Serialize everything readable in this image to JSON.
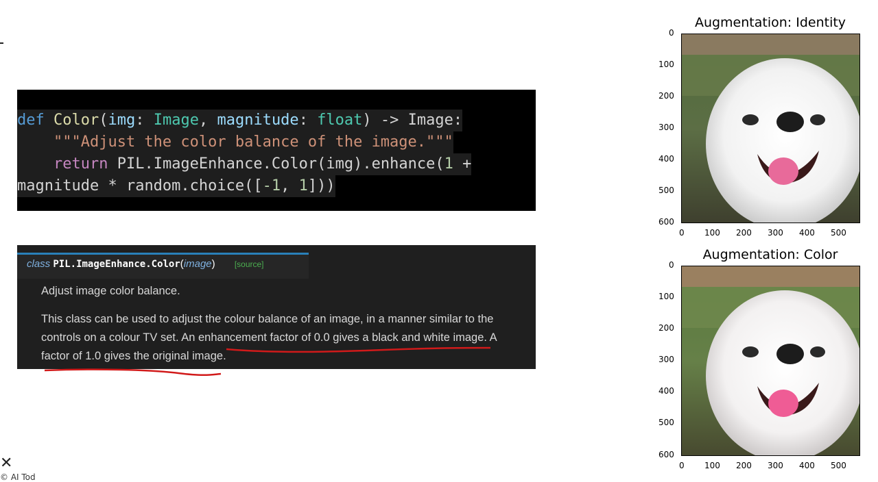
{
  "code": {
    "line1": {
      "kw": "def",
      "fn": "Color",
      "p1": "img",
      "t1": "Image",
      "p2": "magnitude",
      "t2": "float",
      "ret_type": "Image"
    },
    "line2": {
      "doc": "\"\"\"Adjust the color balance of the image.\"\"\""
    },
    "line3": {
      "kw": "return",
      "call": "PIL.ImageEnhance.Color",
      "arg": "img",
      "method": "enhance",
      "num": "1"
    },
    "line4": {
      "text1": "magnitude ",
      "op": "*",
      "text2": " random.choice([",
      "n1": "-1",
      "n2": "1",
      "close": "]))"
    }
  },
  "docs": {
    "class_kw": "class",
    "class_name": "PIL.ImageEnhance.Color",
    "arg": "image",
    "source_link": "[source]",
    "summary": "Adjust image color balance.",
    "body_line1": "This class can be used to adjust the colour balance of an image, in a manner similar to the",
    "body_line2": "controls on a colour TV set. An enhancement factor of 0.0 gives a black and white image. A",
    "body_line3": "factor of 1.0 gives the original image."
  },
  "plots": [
    {
      "title": "Augmentation: Identity",
      "yticks": [
        "0",
        "100",
        "200",
        "300",
        "400",
        "500",
        "600"
      ],
      "xticks": [
        "0",
        "100",
        "200",
        "300",
        "400",
        "500"
      ]
    },
    {
      "title": "Augmentation: Color",
      "yticks": [
        "0",
        "100",
        "200",
        "300",
        "400",
        "500",
        "600"
      ],
      "xticks": [
        "0",
        "100",
        "200",
        "300",
        "400",
        "500"
      ]
    }
  ],
  "colors": {
    "annotation": "#d11a1a",
    "code_bg": "#000000",
    "doc_bg": "#1f1f1f"
  },
  "icons": {
    "corner": "close-icon"
  },
  "footer_text": "© AI Tod"
}
